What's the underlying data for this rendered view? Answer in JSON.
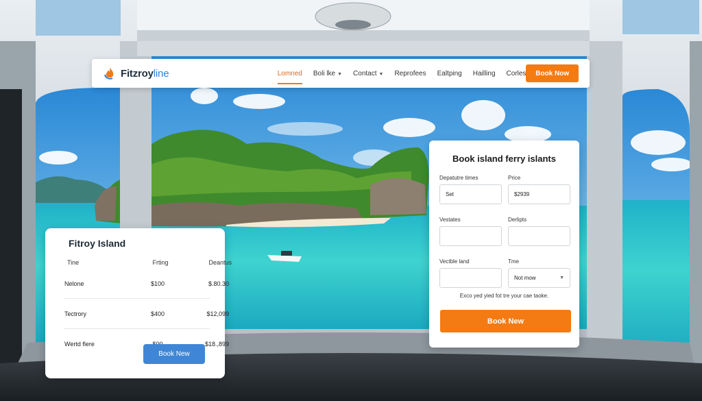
{
  "colors": {
    "accent_orange": "#f47a12",
    "accent_blue": "#3f87d6",
    "sea": "#2fc6cf",
    "sky": "#3d9be0"
  },
  "nav": {
    "logo_icon": "flame-logo-icon",
    "brand_main": "Fitzroy",
    "brand_accent": "line",
    "links": [
      {
        "label": "Lomned",
        "active": true,
        "has_caret": false
      },
      {
        "label": "Boli lke",
        "active": false,
        "has_caret": true
      },
      {
        "label": "Contact",
        "active": false,
        "has_caret": true
      },
      {
        "label": "Reprofees",
        "active": false,
        "has_caret": false
      },
      {
        "label": "Ealtping",
        "active": false,
        "has_caret": false
      },
      {
        "label": "Hailling",
        "active": false,
        "has_caret": false
      },
      {
        "label": "Corles",
        "active": false,
        "has_caret": false
      }
    ],
    "book_label": "Book Now"
  },
  "schedule": {
    "title": "Fitroy Island",
    "headers": [
      "Tine",
      "Frting",
      "Deantus"
    ],
    "rows": [
      [
        "Nelone",
        "$100",
        "$.80.30"
      ],
      [
        "Tectrory",
        "$400",
        "$12,099"
      ],
      [
        "Wertd flere",
        "$00",
        "$18.,899"
      ]
    ],
    "book_label": "Book New"
  },
  "booking": {
    "title": "Book island ferry islants",
    "fields": [
      {
        "label": "Depatutre times",
        "value": ""
      },
      {
        "label": "Price",
        "value": ""
      },
      {
        "label": "Vestates",
        "value": ""
      },
      {
        "label": "Derlipts",
        "value": ""
      },
      {
        "label": "Vectble land",
        "value": ""
      },
      {
        "label": "Tme",
        "value": "Not mow"
      }
    ],
    "values": {
      "departure": "Set",
      "price": "$2939",
      "time": "Not mow"
    },
    "note": "Exco yed yied fot tre your cae taoke.",
    "book_label": "Book New"
  }
}
